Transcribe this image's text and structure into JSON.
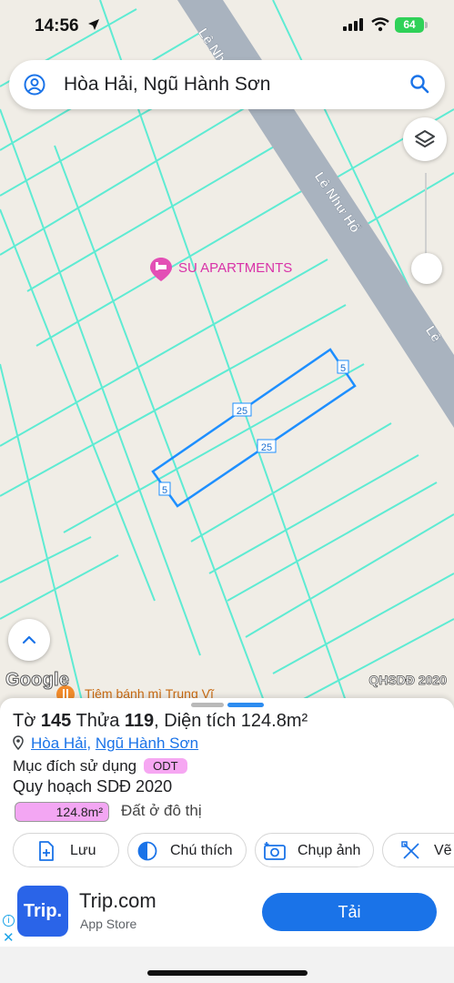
{
  "status_bar": {
    "time": "14:56",
    "battery": "64"
  },
  "search": {
    "text": "Hòa Hải, Ngũ Hành Sơn"
  },
  "map": {
    "road_name": "Lê Như Hổ",
    "road_name_partial_top": "Lê Như",
    "road_name_partial_right": "Lê",
    "poi": "SU APARTMENTS",
    "bakery": "Tiệm bánh mì Trung Vĩ",
    "google": "Google",
    "layer_label": "QHSDĐ 2020",
    "parcel_dims": {
      "long_top": "25",
      "long_bottom": "25",
      "short_right": "5",
      "short_left": "5"
    }
  },
  "sheet": {
    "title_prefix": "Tờ",
    "sheet_no": "145",
    "plot_prefix": "Thửa",
    "plot_no": "119",
    "area_text": ", Diện tích 124.8m²",
    "ward": "Hòa Hải",
    "district": "Ngũ Hành Sơn",
    "purpose_label": "Mục đích sử dụng",
    "purpose_code": "ODT",
    "plan_label": "Quy hoạch SDĐ 2020",
    "area_value": "124.8m²",
    "area_desc": "Đất ở đô thị",
    "actions": [
      "Lưu",
      "Chú thích",
      "Chụp ảnh",
      "Vẽ"
    ]
  },
  "ad": {
    "logo": "Trip.",
    "name": "Trip.com",
    "store": "App Store",
    "button": "Tải"
  },
  "colors": {
    "accent": "#1a73e8",
    "parcel": "#1e8fff",
    "grid": "#58ead1",
    "road": "#a9b3bf"
  }
}
